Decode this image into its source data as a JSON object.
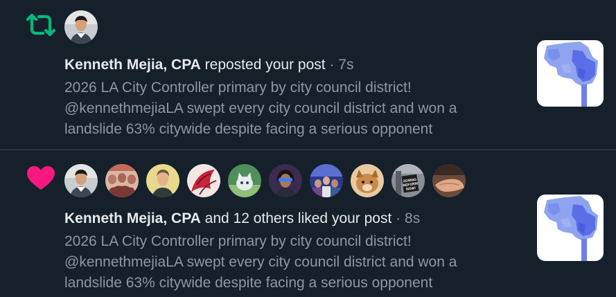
{
  "notifications": [
    {
      "type": "repost",
      "icon": "repost-icon",
      "icon_color": "#00ba7c",
      "avatars": [
        "kenneth-mejia-avatar"
      ],
      "name": "Kenneth Mejia, CPA",
      "action": "reposted your post",
      "separator": "·",
      "time": "7s",
      "post_lines": [
        "2026 LA City Controller primary by city council district!",
        "@kennethmejiaLA swept every city council district and won a",
        "landslide 63% citywide despite facing a serious opponent"
      ],
      "thumbnail": "district-map-thumbnail"
    },
    {
      "type": "like",
      "icon": "heart-icon",
      "icon_color": "#f91880",
      "avatars": [
        "kenneth-mejia-avatar",
        "group-photo-avatar",
        "portrait-avatar",
        "red-drawing-avatar",
        "cat-avatar",
        "woman-avatar",
        "crowd-avatar",
        "dog-avatar",
        "zoning-sign-avatar",
        "hand-avatar"
      ],
      "name": "Kenneth Mejia, CPA",
      "action": "and 12 others liked your post",
      "separator": "·",
      "time": "8s",
      "post_lines": [
        "2026 LA City Controller primary by city council district!",
        "@kennethmejiaLA swept every city council district and won a",
        "landslide 63% citywide despite facing a serious opponent"
      ],
      "thumbnail": "district-map-thumbnail"
    }
  ],
  "colors": {
    "background": "#15202b",
    "divider": "#38444d",
    "primary_text": "#e7e9ea",
    "secondary_text": "#8b98a5",
    "map_light": "#8ea4ef",
    "map_dark": "#5b6ee8"
  },
  "avatar_labels": {
    "zoning_sign": [
      "ZONING",
      "REFORM",
      "NOW!"
    ]
  }
}
